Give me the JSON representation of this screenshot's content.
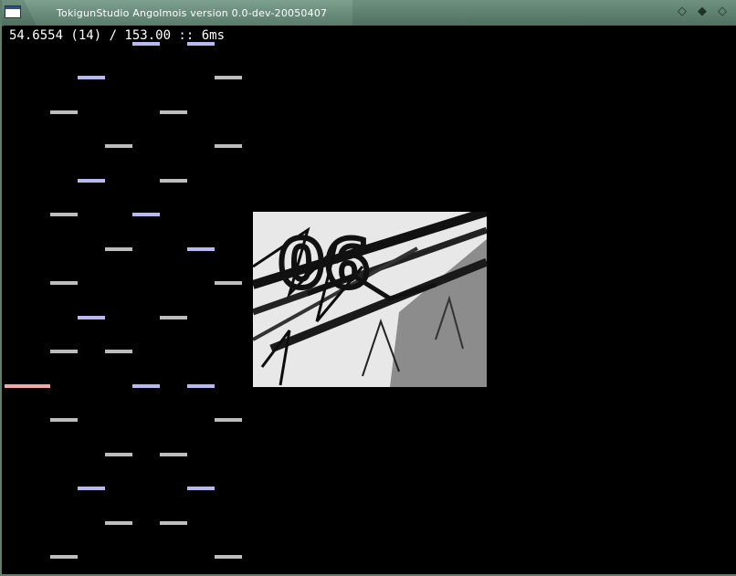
{
  "window": {
    "title": "TokigunStudio Angolmois version 0.0-dev-20050407"
  },
  "hud": {
    "status_text": "54.6554 (14) / 153.00 :: 6ms"
  },
  "bga": {
    "overlay_text": "06"
  },
  "colors": {
    "note_white": "#bdbdbd",
    "note_blue": "#b8b8f2",
    "note_red": "#f2a8a8",
    "titlebar": "#5f7f6c"
  }
}
